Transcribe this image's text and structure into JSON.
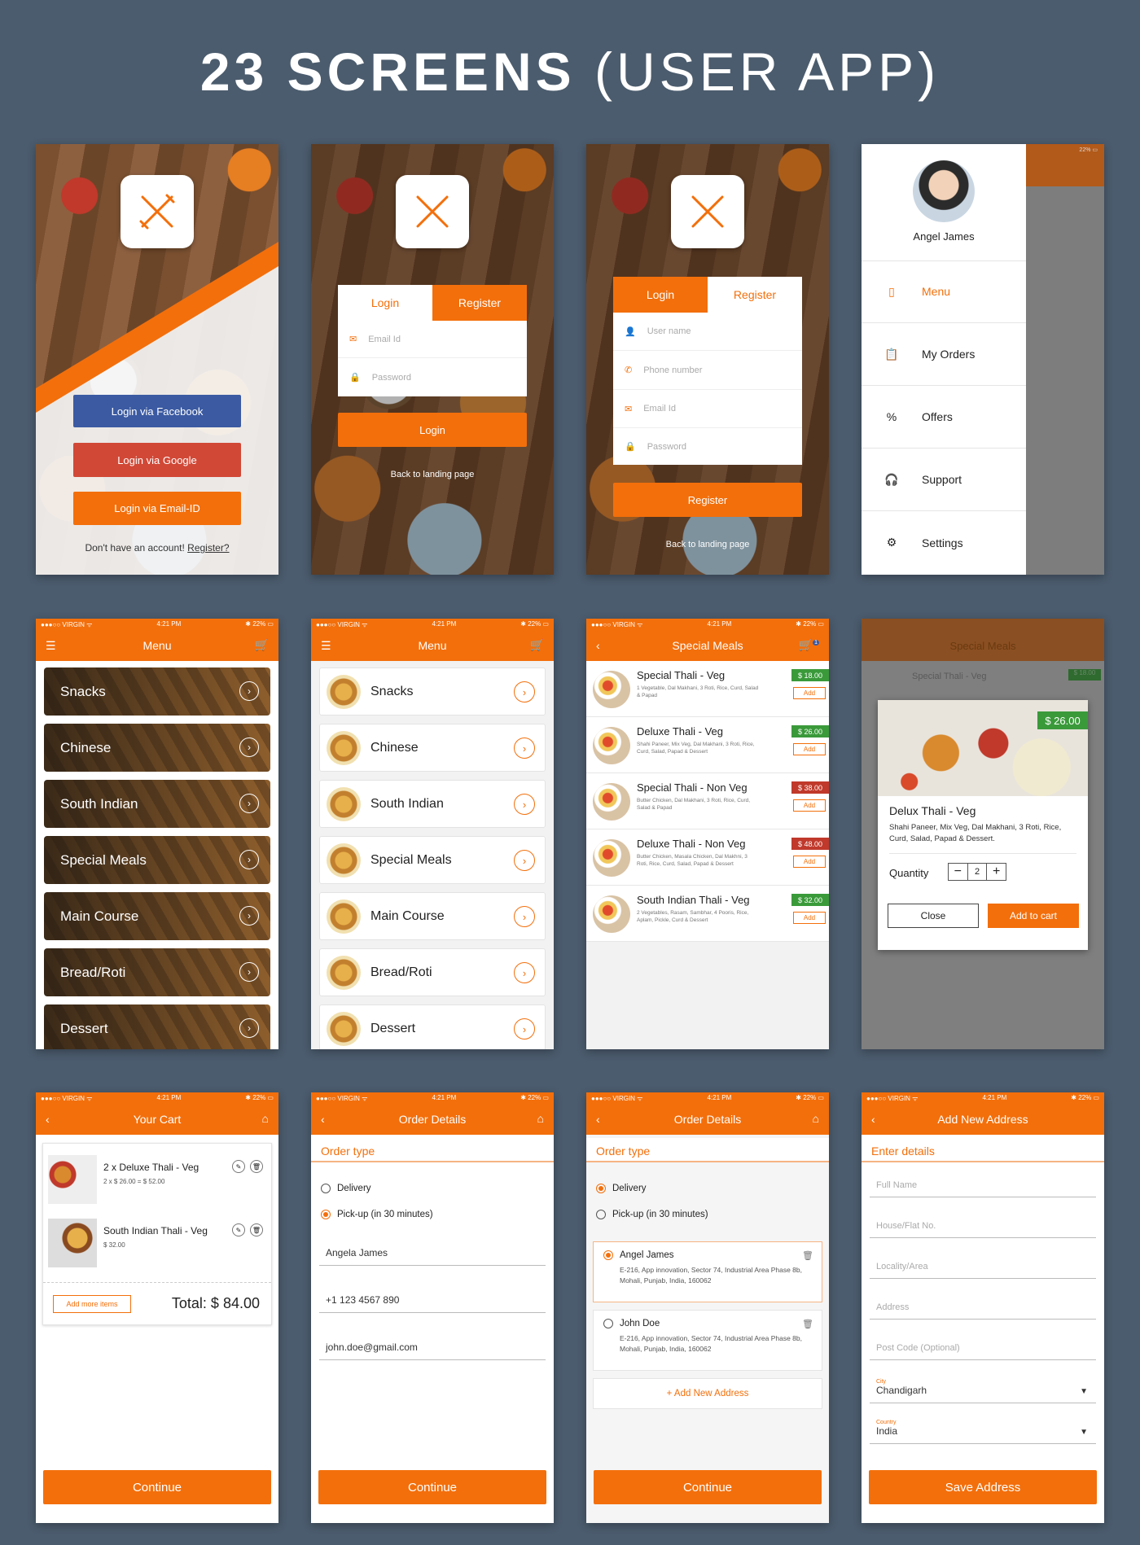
{
  "title_bold": "23 SCREENS",
  "title_rest": " (USER APP)",
  "status": {
    "carrier": "●●●○○ VIRGIN ᯤ",
    "time": "4:21 PM",
    "battery": "✱ 22% ▭"
  },
  "landing": {
    "facebook": "Login via Facebook",
    "google": "Login via Google",
    "email": "Login via Email-ID",
    "no_account": "Don't have an account!",
    "register": "Register?"
  },
  "login": {
    "tab_login": "Login",
    "tab_register": "Register",
    "email_ph": "Email Id",
    "password_ph": "Password",
    "login_btn": "Login",
    "back": "Back to landing page"
  },
  "register": {
    "tab_login": "Login",
    "tab_register": "Register",
    "user_ph": "User name",
    "phone_ph": "Phone number",
    "email_ph": "Email Id",
    "password_ph": "Password",
    "register_btn": "Register",
    "back": "Back to landing page"
  },
  "drawer": {
    "name": "Angel James",
    "status_right": "22% ▭",
    "items": [
      "Menu",
      "My Orders",
      "Offers",
      "Support",
      "Settings"
    ]
  },
  "menu": {
    "title": "Menu",
    "items": [
      "Snacks",
      "Chinese",
      "South Indian",
      "Special Meals",
      "Main Course",
      "Bread/Roti",
      "Dessert"
    ]
  },
  "special": {
    "title": "Special Meals",
    "badge": "1",
    "add": "Add",
    "items": [
      {
        "name": "Special Thali - Veg",
        "desc": "1 Vegetable, Dal Makhani, 3 Roti, Rice, Curd, Salad & Papad",
        "price": "$ 18.00",
        "veg": true
      },
      {
        "name": "Deluxe Thali - Veg",
        "desc": "Shahi Paneer, Mix Veg, Dal Makhani, 3 Roti, Rice, Curd, Salad, Papad & Dessert",
        "price": "$ 26.00",
        "veg": true
      },
      {
        "name": "Special Thali - Non Veg",
        "desc": "Butter Chicken, Dal Makhani, 3 Roti, Rice, Curd, Salad & Papad",
        "price": "$ 38.00",
        "veg": false
      },
      {
        "name": "Deluxe Thali - Non Veg",
        "desc": "Butter Chicken, Masala Chicken, Dal Makhni, 3 Roti, Rice, Curd, Salad, Papad & Dessert",
        "price": "$ 48.00",
        "veg": false
      },
      {
        "name": "South Indian Thali - Veg",
        "desc": "2 Vegetables, Rasam, Sambhar, 4 Pooris, Rice, Aplam, Pickle, Curd & Dessert",
        "price": "$ 32.00",
        "veg": true
      }
    ]
  },
  "popup": {
    "bg_title": "Special Meals",
    "bg_item": "Special Thali - Veg",
    "bg_price": "$ 18.00",
    "price": "$ 26.00",
    "name": "Delux Thali - Veg",
    "desc": "Shahi Paneer, Mix Veg, Dal Makhani, 3 Roti, Rice, Curd, Salad, Papad & Dessert.",
    "qty_label": "Quantity",
    "qty": "2",
    "minus": "−",
    "plus": "+",
    "close": "Close",
    "add_cart": "Add to cart"
  },
  "cart": {
    "title": "Your Cart",
    "items": [
      {
        "name": "2 x Deluxe Thali - Veg",
        "sub": "2 x $ 26.00 = $ 52.00"
      },
      {
        "name": "South Indian Thali - Veg",
        "sub": "$ 32.00"
      }
    ],
    "add_more": "Add more items",
    "total": "Total: $ 84.00",
    "continue": "Continue"
  },
  "order1": {
    "title": "Order Details",
    "order_type": "Order type",
    "delivery": "Delivery",
    "pickup": "Pick-up (in 30 minutes)",
    "name": "Angela James",
    "phone": "+1 123 4567 890",
    "email": "john.doe@gmail.com",
    "continue": "Continue"
  },
  "order2": {
    "title": "Order Details",
    "order_type": "Order type",
    "delivery": "Delivery",
    "pickup": "Pick-up (in 30 minutes)",
    "addresses": [
      {
        "name": "Angel James",
        "addr": "E-216, App innovation, Sector 74, Industrial Area Phase 8b, Mohali, Punjab, India, 160062"
      },
      {
        "name": "John Doe",
        "addr": "E-216, App innovation, Sector 74, Industrial Area Phase 8b, Mohali, Punjab, India, 160062"
      }
    ],
    "add_new": "+ Add New Address",
    "continue": "Continue"
  },
  "address": {
    "title": "Add New Address",
    "enter": "Enter details",
    "full_name": "Full Name",
    "house": "House/Flat No.",
    "locality": "Locality/Area",
    "address": "Address",
    "post": "Post Code (Optional)",
    "city_label": "City",
    "city": "Chandigarh",
    "country_label": "Country",
    "country": "India",
    "save": "Save Address"
  },
  "colors": {
    "accent": "#f36f0b",
    "facebook": "#3b5aa2",
    "google": "#d14836",
    "bg": "#4b5c6e",
    "veg": "#3a9a3a",
    "nonveg": "#c0392b"
  }
}
